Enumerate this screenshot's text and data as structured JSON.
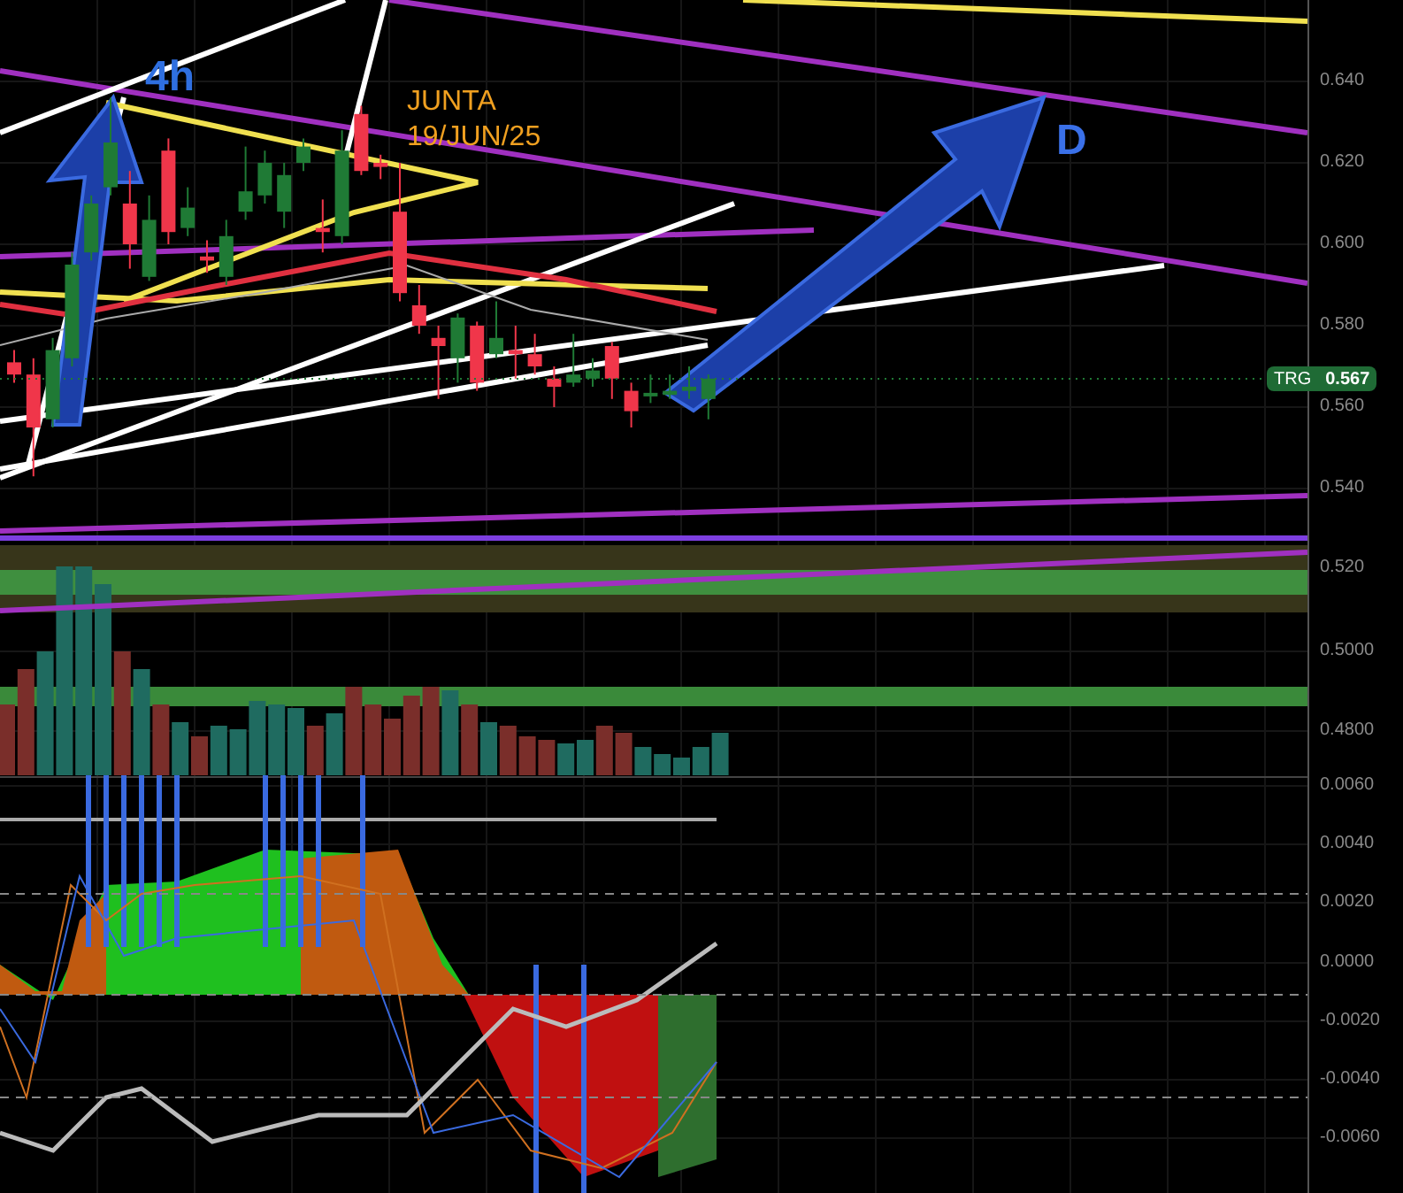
{
  "annotations": [
    {
      "kind": "timeframe",
      "lines": [
        "4h"
      ]
    },
    {
      "kind": "note",
      "lines": [
        "JUNTA",
        "19/JUN/25"
      ]
    },
    {
      "kind": "target",
      "lines": [
        "D"
      ]
    }
  ],
  "price_axis": [
    "0.640",
    "0.620",
    "0.600",
    "0.580",
    "0.560",
    "0.540",
    "0.520",
    "0.5000",
    "0.4800"
  ],
  "price_tag": {
    "symbol": "TRG",
    "value": "0.567"
  },
  "oscillator_axis": [
    "0.0060",
    "0.0040",
    "0.0020",
    "0.0000",
    "-0.0020",
    "-0.0040",
    "-0.0060"
  ]
}
